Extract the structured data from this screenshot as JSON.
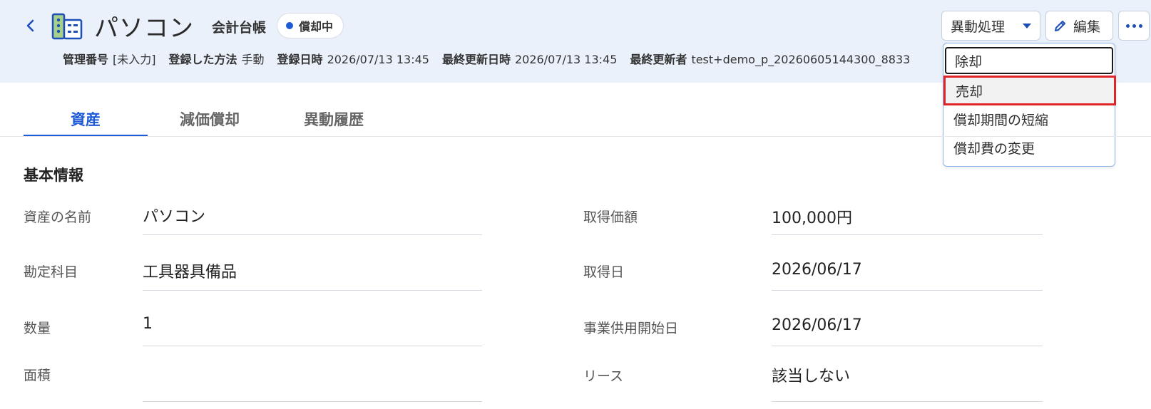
{
  "header": {
    "title": "パソコン",
    "ledger": "会計台帳",
    "status": "償却中",
    "meta": [
      {
        "key": "管理番号",
        "value": "[未入力]"
      },
      {
        "key": "登録した方法",
        "value": "手動"
      },
      {
        "key": "登録日時",
        "value": "2026/07/13 13:45"
      },
      {
        "key": "最終更新日時",
        "value": "2026/07/13 13:45"
      },
      {
        "key": "最終更新者",
        "value": "test+demo_p_20260605144300_8833"
      }
    ]
  },
  "actions": {
    "transfer_label": "異動処理",
    "edit_label": "編集",
    "menu": [
      "除却",
      "売却",
      "償却期間の短縮",
      "償却費の変更"
    ]
  },
  "tabs": [
    "資産",
    "減価償却",
    "異動履歴"
  ],
  "section": {
    "title": "基本情報",
    "left": [
      {
        "label": "資産の名前",
        "value": "パソコン"
      },
      {
        "label": "勘定科目",
        "value": "工具器具備品"
      },
      {
        "label": "数量",
        "value": "1"
      },
      {
        "label": "面積",
        "value": ""
      }
    ],
    "right": [
      {
        "label": "取得価額",
        "value": "100,000円"
      },
      {
        "label": "取得日",
        "value": "2026/06/17"
      },
      {
        "label": "事業供用開始日",
        "value": "2026/06/17"
      },
      {
        "label": "リース",
        "value": "該当しない"
      }
    ]
  },
  "colors": {
    "accent": "#1d5bd8",
    "header_bg": "#eaf1fb",
    "highlight": "#e0252a"
  }
}
